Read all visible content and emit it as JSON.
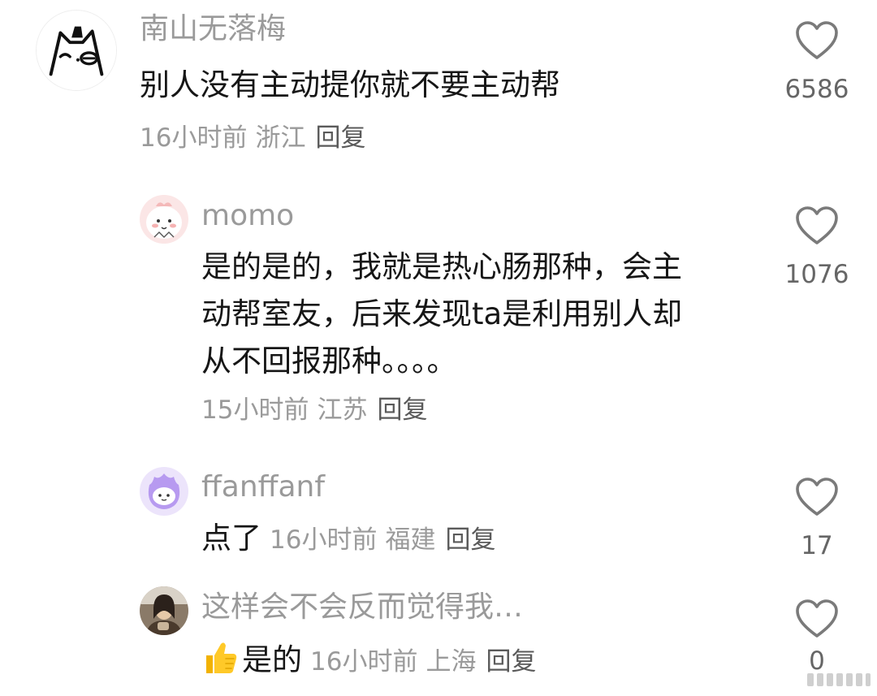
{
  "comments": [
    {
      "username": "南山无落梅",
      "text_lines": [
        "别人没有主动提你就不要主动帮"
      ],
      "time": "16小时前",
      "location": "浙江",
      "reply": "回复",
      "likes": "6586",
      "avatar_icon": "cat-doodle-avatar"
    },
    {
      "username": "momo",
      "text_lines": [
        "是的是的，我就是热心肠那种，会主",
        "动帮室友，后来发现ta是利用别人却",
        "从不回报那种。。。。"
      ],
      "time": "15小时前",
      "location": "江苏",
      "reply": "回复",
      "likes": "1076",
      "avatar_icon": "pink-bunny-avatar"
    },
    {
      "username": "ffanffanf",
      "text": "点了",
      "time": "16小时前",
      "location": "福建",
      "reply": "回复",
      "likes": "17",
      "avatar_icon": "purple-flame-cat-avatar"
    },
    {
      "username": "这样会不会反而觉得我…",
      "text": "是的",
      "emoji": "thumbs-up",
      "time": "16小时前",
      "location": "上海",
      "reply": "回复",
      "likes": "0",
      "avatar_icon": "person-photo-avatar"
    }
  ],
  "colors": {
    "username": "#9a9a9a",
    "text": "#161616",
    "meta": "#9a9a9a",
    "heart": "#7a7a7a"
  }
}
